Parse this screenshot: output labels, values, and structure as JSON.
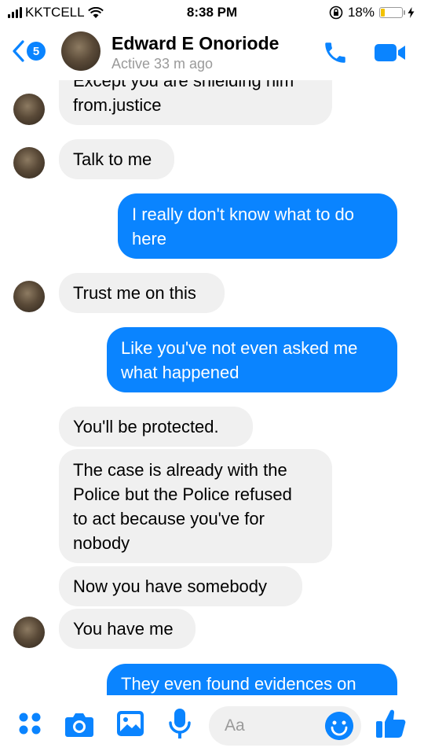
{
  "status_bar": {
    "carrier": "KKTCELL",
    "time": "8:38 PM",
    "battery_percent": "18%",
    "battery_level": 0.18
  },
  "header": {
    "back_badge_count": "5",
    "contact_name": "Edward E Onoriode",
    "contact_status": "Active 33 m ago"
  },
  "messages": [
    {
      "side": "in",
      "text": "Except you are shielding him\nfrom.justice"
    },
    {
      "side": "in",
      "text": "Talk to me"
    },
    {
      "side": "out",
      "text": "I really don't know what to do\nhere"
    },
    {
      "side": "in",
      "text": "Trust me on this"
    },
    {
      "side": "out",
      "text": "Like you've not even asked me\nwhat happened"
    },
    {
      "side": "in",
      "text": "You'll be protected."
    },
    {
      "side": "in",
      "text": "The case is already with the\nPolice but the Police refused\nto act because you've for\nnobody"
    },
    {
      "side": "in",
      "text": "Now you have somebody"
    },
    {
      "side": "in",
      "text": "You have me"
    },
    {
      "side": "out",
      "text": "They even found evidences on"
    }
  ],
  "composer": {
    "placeholder": "Aa"
  },
  "colors": {
    "accent": "#0a84ff",
    "incoming_bubble": "#f0f0f0",
    "battery": "#f2c200"
  },
  "icons": {
    "header": [
      "back-chevron-icon",
      "phone-icon",
      "video-camera-icon"
    ],
    "composer": [
      "menu-dots-icon",
      "camera-icon",
      "gallery-icon",
      "microphone-icon",
      "smiley-icon",
      "thumbs-up-icon"
    ]
  }
}
